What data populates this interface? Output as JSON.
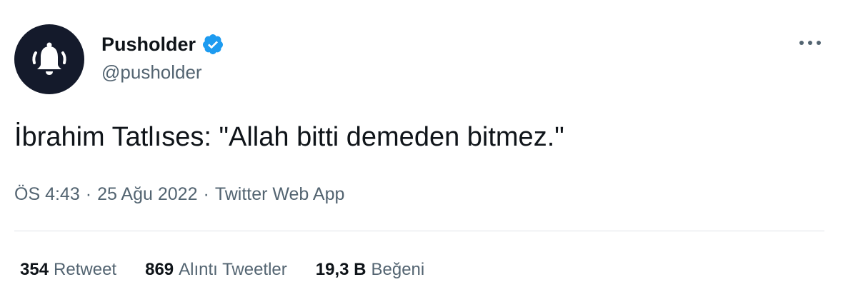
{
  "user": {
    "display_name": "Pusholder",
    "handle": "@pusholder",
    "verified": true,
    "avatar_icon": "bell-icon"
  },
  "tweet": {
    "text": "İbrahim Tatlıses: \"Allah bitti demeden bitmez.\""
  },
  "meta": {
    "time": "ÖS 4:43",
    "separator": "·",
    "date": "25 Ağu 2022",
    "source": "Twitter Web App"
  },
  "stats": [
    {
      "count": "354",
      "label": "Retweet"
    },
    {
      "count": "869",
      "label": "Alıntı Tweetler"
    },
    {
      "count": "19,3 B",
      "label": "Beğeni"
    }
  ],
  "colors": {
    "text": "#0f1419",
    "secondary": "#536471",
    "verified": "#1d9bf0",
    "avatar_bg": "#141a2b",
    "divider": "#dfe4e8"
  }
}
